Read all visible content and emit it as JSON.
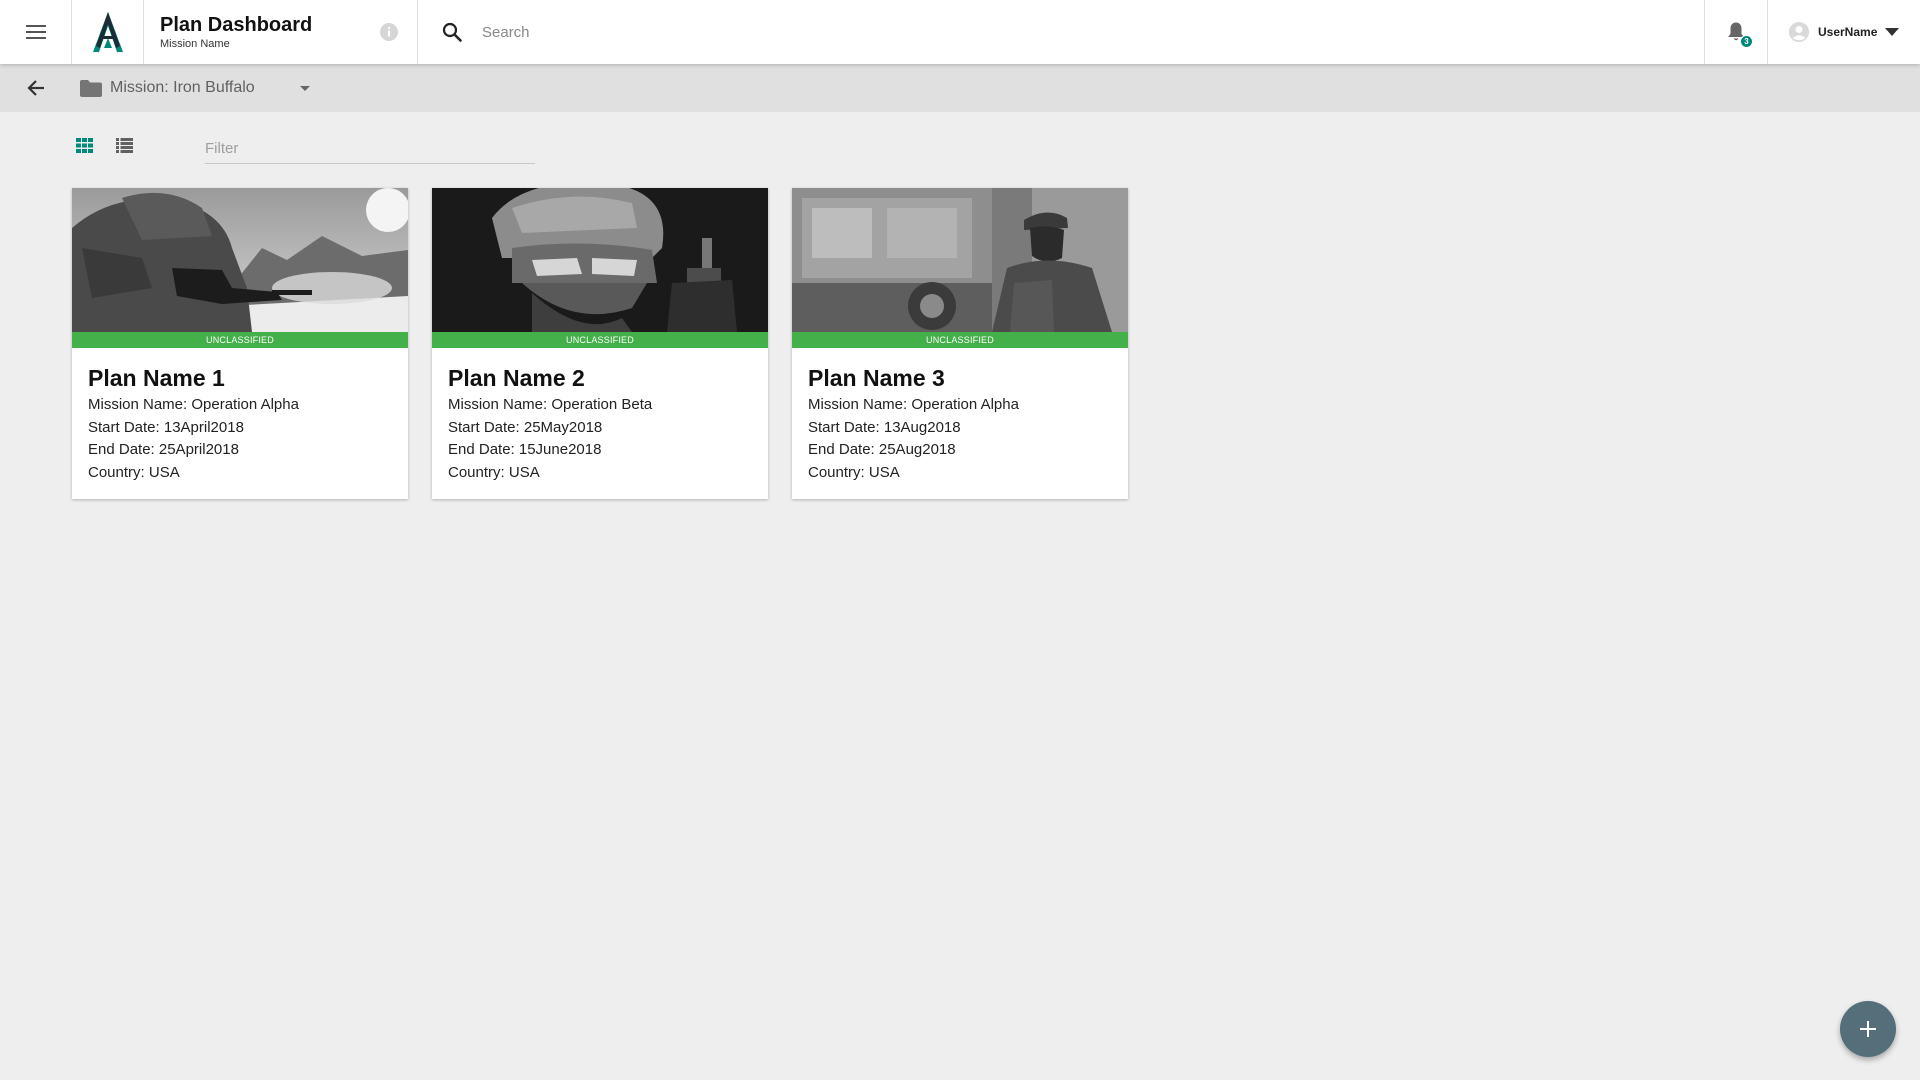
{
  "header": {
    "title": "Plan Dashboard",
    "subtitle": "Mission Name",
    "search_placeholder": "Search",
    "notification_count": "3",
    "user_name": "UserName"
  },
  "icons": {
    "menu": "menu-icon",
    "logo": "app-logo",
    "info": "info-icon",
    "search": "search-icon",
    "notifications": "bell-icon",
    "user": "account-circle-icon",
    "user_menu": "caret-down-icon",
    "back": "arrow-back-icon",
    "folder": "folder-icon",
    "dropdown": "dropdown-arrow-icon",
    "grid_view": "grid-view-icon",
    "list_view": "list-view-icon",
    "fab": "plus-icon"
  },
  "subbar": {
    "mission_selected": "Mission: Iron Buffalo"
  },
  "toolbar": {
    "filter_placeholder": "Filter",
    "active_view": "grid"
  },
  "colors": {
    "accent": "#00897b",
    "classification_banner": "#43b049",
    "fab": "#546e7a",
    "background": "#eeeeee"
  },
  "plans": [
    {
      "classification": "UNCLASSIFIED",
      "name": "Plan Name 1",
      "mission": "Mission Name: Operation Alpha",
      "start": "Start Date: 13April2018",
      "end": "End Date: 25April2018",
      "country": "Country: USA"
    },
    {
      "classification": "UNCLASSIFIED",
      "name": "Plan Name 2",
      "mission": "Mission Name: Operation Beta",
      "start": "Start Date: 25May2018",
      "end": "End Date: 15June2018",
      "country": "Country: USA"
    },
    {
      "classification": "UNCLASSIFIED",
      "name": "Plan Name 3",
      "mission": "Mission Name: Operation Alpha",
      "start": "Start Date: 13Aug2018",
      "end": "End Date: 25Aug2018",
      "country": "Country: USA"
    }
  ]
}
